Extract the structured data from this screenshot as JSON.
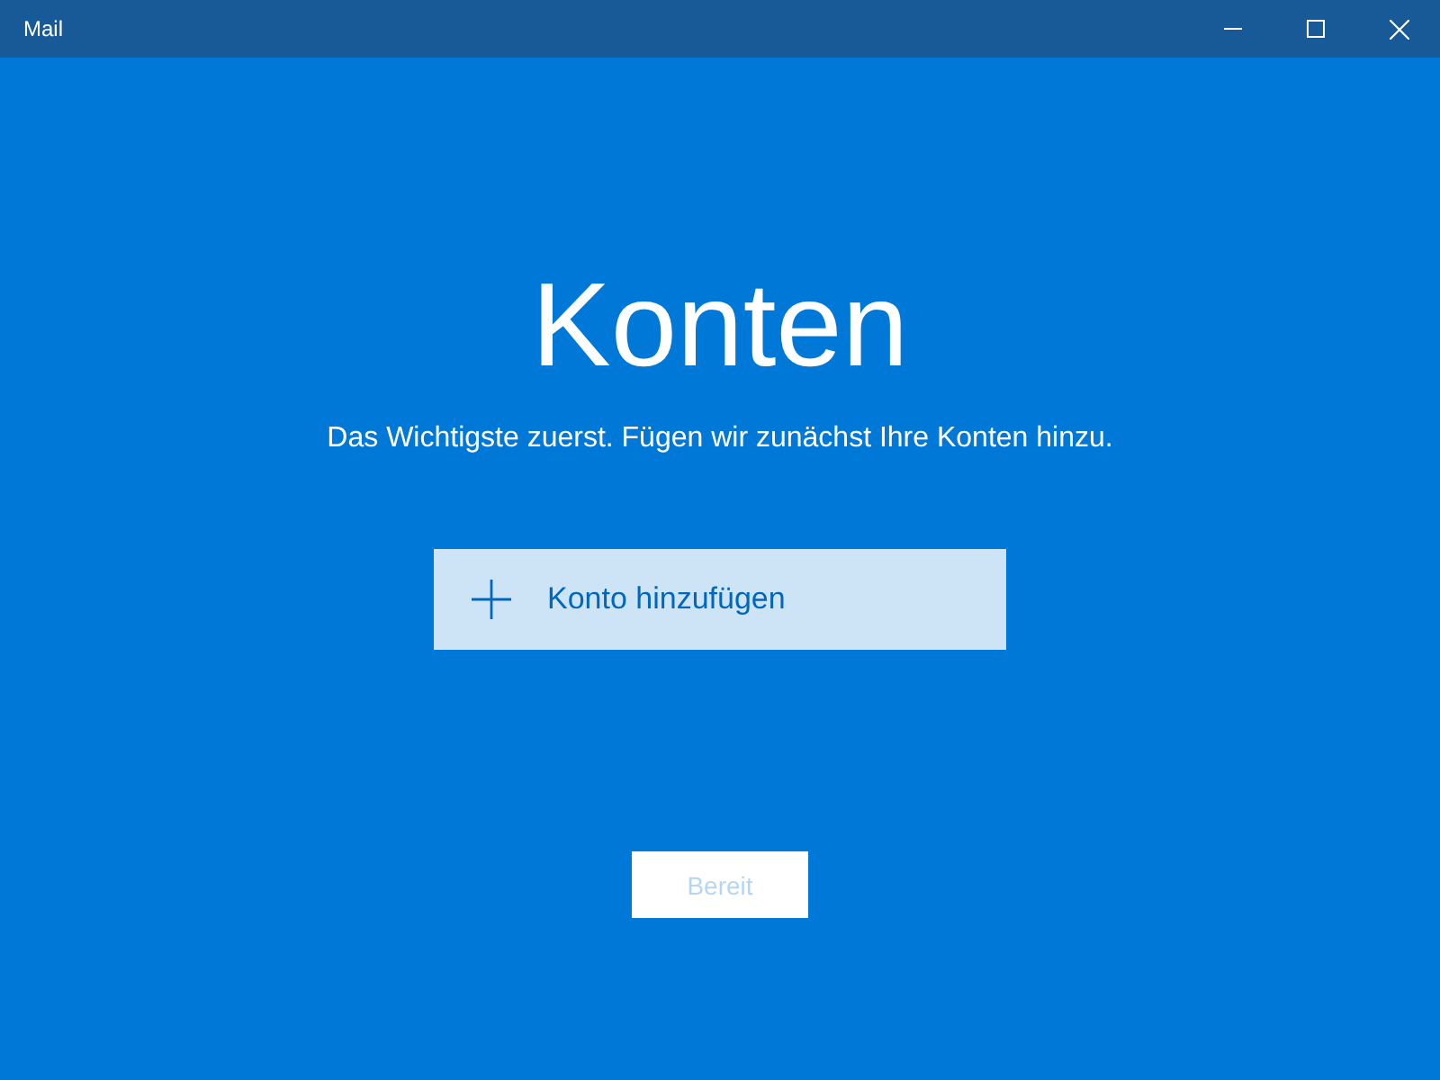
{
  "window": {
    "title": "Mail"
  },
  "heading": "Konten",
  "subtitle": "Das Wichtigste zuerst. Fügen wir zunächst Ihre Konten hinzu.",
  "add_account_button": {
    "label": "Konto hinzufügen"
  },
  "done_button": {
    "label": "Bereit",
    "disabled": true
  }
}
